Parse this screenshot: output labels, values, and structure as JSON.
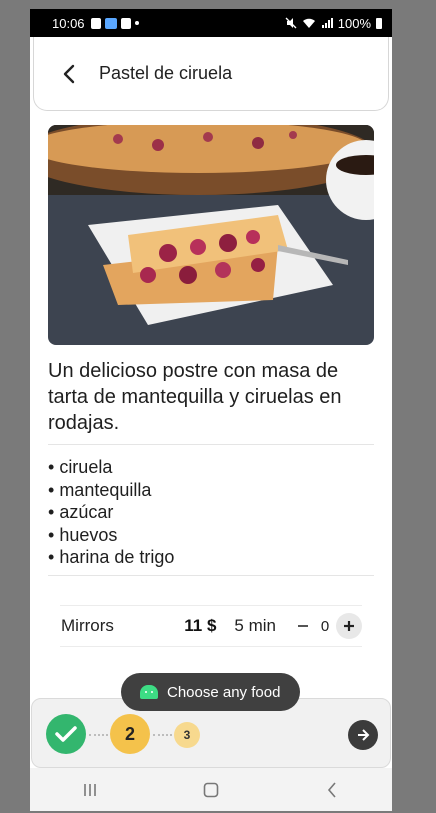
{
  "status_bar": {
    "time": "10:06",
    "battery": "100%"
  },
  "header": {
    "title": "Pastel de ciruela",
    "back_icon": "chevron-left-icon"
  },
  "recipe": {
    "description": "Un delicioso postre con masa de tarta de mantequilla y ciruelas en rodajas.",
    "ingredients": [
      "ciruela",
      "mantequilla",
      "azúcar",
      "huevos",
      "harina de trigo"
    ]
  },
  "mirror": {
    "name": "Mirrors",
    "price": "11 $",
    "time": "5 min",
    "quantity": "0"
  },
  "toast": {
    "text": "Choose any food",
    "icon": "android-icon"
  },
  "stepper": {
    "steps": [
      {
        "label": "",
        "state": "done",
        "icon": "check-icon"
      },
      {
        "label": "2",
        "state": "active"
      },
      {
        "label": "3",
        "state": "upcoming"
      }
    ],
    "next_icon": "arrow-right-icon"
  },
  "colors": {
    "done": "#33b66e",
    "active": "#f4c24b",
    "upcoming": "#f7d98e",
    "toast": "#404040"
  }
}
